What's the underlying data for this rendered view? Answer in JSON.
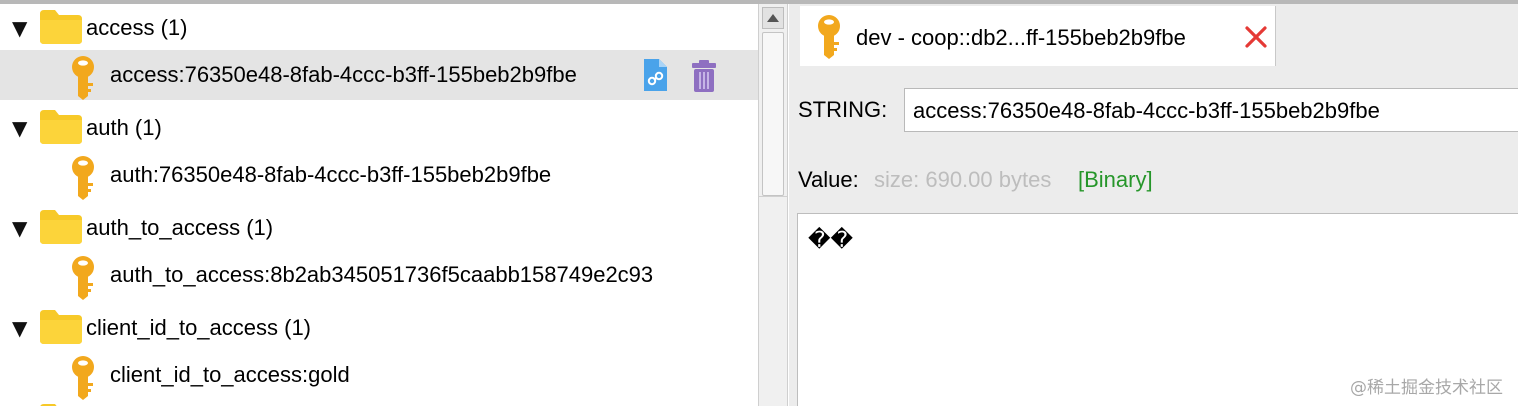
{
  "tree": {
    "rows": [
      {
        "kind": "folder",
        "label": "access (1)",
        "expanded_glyph": "▼"
      },
      {
        "kind": "key",
        "label": "access:76350e48-8fab-4ccc-b3ff-155beb2b9fbe",
        "selected": true,
        "actions": [
          "copy-link-icon",
          "trash-icon"
        ]
      },
      {
        "kind": "folder",
        "label": "auth (1)",
        "expanded_glyph": "▼"
      },
      {
        "kind": "key",
        "label": "auth:76350e48-8fab-4ccc-b3ff-155beb2b9fbe"
      },
      {
        "kind": "folder",
        "label": "auth_to_access (1)",
        "expanded_glyph": "▼"
      },
      {
        "kind": "key",
        "label": "auth_to_access:8b2ab345051736f5caabb158749e2c93"
      },
      {
        "kind": "folder",
        "label": "client_id_to_access (1)",
        "expanded_glyph": "▼"
      },
      {
        "kind": "key",
        "label": "client_id_to_access:gold"
      }
    ]
  },
  "tab": {
    "title": "dev - coop::db2...ff-155beb2b9fbe",
    "icon": "key-icon",
    "close_icon": "close-icon"
  },
  "detail": {
    "type_label": "STRING:",
    "key_name": "access:76350e48-8fab-4ccc-b3ff-155beb2b9fbe",
    "value_label": "Value:",
    "size_text": "size: 690.00 bytes",
    "format_text": "[Binary]",
    "value_content": "��"
  },
  "watermark": "@稀土掘金技术社区",
  "colors": {
    "folder": "#f7c928",
    "key": "#f2a81d",
    "selected_row": "#e4e4e4",
    "close": "#e53935",
    "binary": "#26962a",
    "size_text": "#bdbdbd",
    "trash": "#8e6fc1"
  }
}
